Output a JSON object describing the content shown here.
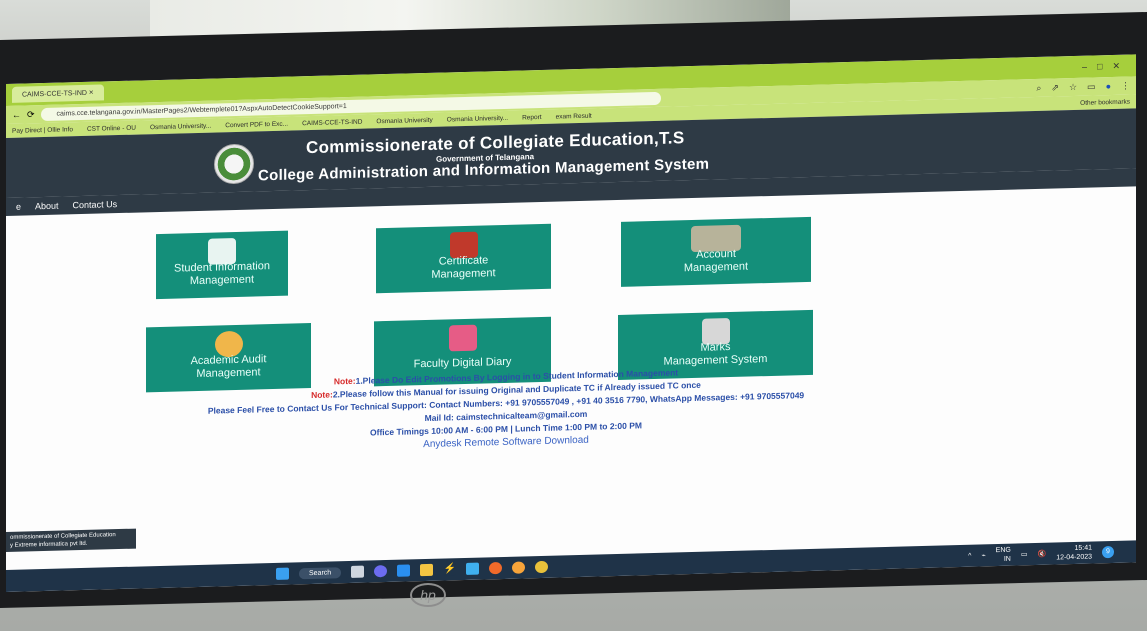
{
  "browser": {
    "tab_title": "CAIMS-CCE-TS-IND",
    "tab_close": "×",
    "url": "caims.cce.telangana.gov.in/MasterPages2/Webtemplete01?AspxAutoDetectCookieSupport=1",
    "bookmarks": [
      "Pay Direct | Ollie Info",
      "CST Online - OU",
      "Osmania University...",
      "Convert PDF to Exc...",
      "CAIMS-CCE-TS-IND",
      "Osmania University",
      "Osmania University...",
      "Report",
      "exam Result"
    ],
    "other_bookmarks": "Other bookmarks"
  },
  "header": {
    "title": "Commissionerate of Collegiate Education,T.S",
    "subtitle": "Government of Telangana",
    "system": "College Administration and Information Management System"
  },
  "nav": {
    "items": [
      "e",
      "About",
      "Contact Us"
    ]
  },
  "tiles": [
    {
      "label1": "Student Information",
      "label2": "Management",
      "icon_color": "#e8f4f1"
    },
    {
      "label1": "Certificate",
      "label2": "Management",
      "icon_color": "#c0392b"
    },
    {
      "label1": "Account",
      "label2": "Management",
      "icon_color": "#b7b39a"
    },
    {
      "label1": "Academic Audit",
      "label2": "Management",
      "icon_color": "#f0b64a"
    },
    {
      "label1": "Faculty Digital Diary",
      "label2": "",
      "icon_color": "#e65c86"
    },
    {
      "label1": "Marks",
      "label2": "Management System",
      "icon_color": "#d7d7d7"
    }
  ],
  "notes": {
    "note1_prefix": "Note:",
    "note1_text": "1.Please Do Edit Promotions By Logging in to Student Information Management",
    "note2_prefix": "Note:",
    "note2_text": "2.Please follow this Manual for issuing Original and Duplicate TC if Already issued TC once",
    "contact": "Please Feel Free to Contact Us For Technical Support: Contact Numbers: +91 9705557049 , +91 40 3516 7790, WhatsApp Messages: +91 9705557049",
    "mail": "Mail Id: caimstechnicalteam@gmail.com",
    "timings": "Office Timings 10:00 AM - 6:00 PM | Lunch Time 1:00 PM to 2:00 PM",
    "anydesk": "Anydesk Remote Software Download"
  },
  "footer": {
    "line1": "ommissionerate of Collegiate Education",
    "line2": "y Extreme informatica pvt ltd."
  },
  "taskbar": {
    "search_label": "Search",
    "lang": "ENG",
    "region": "IN",
    "time": "15:41",
    "date": "12-04-2023",
    "notif": "9"
  },
  "logo": "hp",
  "colors": {
    "tile": "#148f7a",
    "header": "#2e3a45",
    "chrome": "#a6cf3c",
    "note_red": "#d62a2a",
    "note_blue": "#2b4fa8"
  }
}
